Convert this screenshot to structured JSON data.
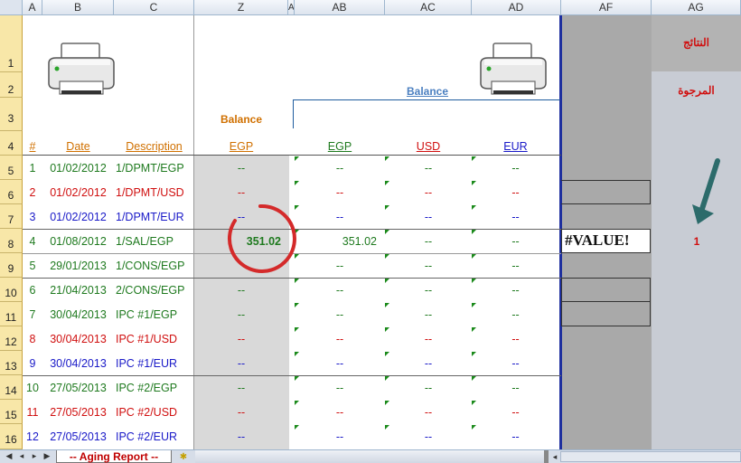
{
  "columns": [
    "A",
    "B",
    "C",
    "Z",
    "A",
    "AB",
    "AC",
    "AD",
    "AF",
    "AG"
  ],
  "row_numbers": [
    "1",
    "2",
    "3",
    "4",
    "5",
    "6",
    "7",
    "8",
    "9",
    "10",
    "11",
    "12",
    "13",
    "14",
    "15",
    "16"
  ],
  "headers": {
    "hash": "#",
    "date": "Date",
    "description": "Description",
    "balance_left": "Balance",
    "balance_top": "Balance",
    "egp_z": "EGP",
    "egp": "EGP",
    "usd": "USD",
    "eur": "EUR"
  },
  "arabic": {
    "results": "النتائج",
    "expected": "المرجوة"
  },
  "error_value": "#VALUE!",
  "side_count": "1",
  "rows": [
    {
      "n": "1",
      "date": "01/02/2012",
      "desc": "1/DPMT/EGP",
      "z": "--",
      "ab": "--",
      "ac": "--",
      "ad": "--",
      "color": "green"
    },
    {
      "n": "2",
      "date": "01/02/2012",
      "desc": "1/DPMT/USD",
      "z": "--",
      "ab": "--",
      "ac": "--",
      "ad": "--",
      "color": "red"
    },
    {
      "n": "3",
      "date": "01/02/2012",
      "desc": "1/DPMT/EUR",
      "z": "--",
      "ab": "--",
      "ac": "--",
      "ad": "--",
      "color": "blue"
    },
    {
      "n": "4",
      "date": "01/08/2012",
      "desc": "1/SAL/EGP",
      "z": "351.02",
      "ab": "351.02",
      "ac": "--",
      "ad": "--",
      "color": "green"
    },
    {
      "n": "5",
      "date": "29/01/2013",
      "desc": "1/CONS/EGP",
      "z": "",
      "ab": "--",
      "ac": "--",
      "ad": "--",
      "color": "green"
    },
    {
      "n": "6",
      "date": "21/04/2013",
      "desc": "2/CONS/EGP",
      "z": "--",
      "ab": "--",
      "ac": "--",
      "ad": "--",
      "color": "green"
    },
    {
      "n": "7",
      "date": "30/04/2013",
      "desc": "IPC #1/EGP",
      "z": "--",
      "ab": "--",
      "ac": "--",
      "ad": "--",
      "color": "green"
    },
    {
      "n": "8",
      "date": "30/04/2013",
      "desc": "IPC #1/USD",
      "z": "--",
      "ab": "--",
      "ac": "--",
      "ad": "--",
      "color": "red"
    },
    {
      "n": "9",
      "date": "30/04/2013",
      "desc": "IPC #1/EUR",
      "z": "--",
      "ab": "--",
      "ac": "--",
      "ad": "--",
      "color": "blue"
    },
    {
      "n": "10",
      "date": "27/05/2013",
      "desc": "IPC #2/EGP",
      "z": "--",
      "ab": "--",
      "ac": "--",
      "ad": "--",
      "color": "green"
    },
    {
      "n": "11",
      "date": "27/05/2013",
      "desc": "IPC #2/USD",
      "z": "--",
      "ab": "--",
      "ac": "--",
      "ad": "--",
      "color": "red"
    },
    {
      "n": "12",
      "date": "27/05/2013",
      "desc": "IPC #2/EUR",
      "z": "--",
      "ab": "--",
      "ac": "--",
      "ad": "--",
      "color": "blue"
    }
  ],
  "sheet_tab": "-- Aging Report --",
  "colors": {
    "green": "#1f7a1f",
    "red": "#d01010",
    "blue": "#1a1ac8",
    "orange": "#d07000",
    "header_bg": "#dde4ee",
    "rowhdr_bg": "#f8e7a8"
  }
}
